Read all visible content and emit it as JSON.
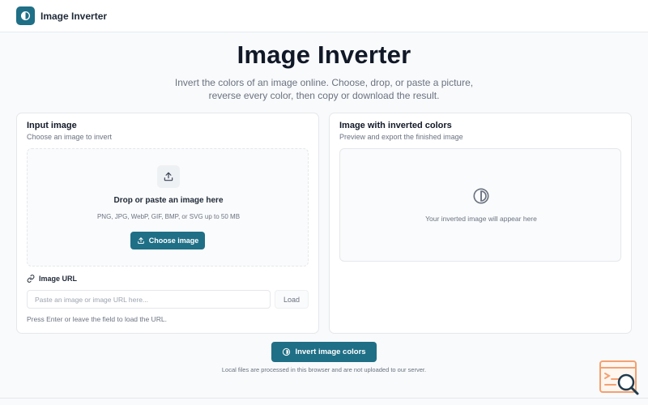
{
  "app": {
    "title": "Image Inverter"
  },
  "hero": {
    "title": "Image Inverter",
    "subtitle": "Invert the colors of an image online. Choose, drop, or paste a picture, reverse every color, then copy or download the result."
  },
  "input_card": {
    "title": "Input image",
    "subtitle": "Choose an image to invert",
    "dropzone": {
      "title": "Drop or paste an image here",
      "formats": "PNG, JPG, WebP, GIF, BMP, or SVG up to 50 MB",
      "button_label": "Choose image"
    },
    "url": {
      "label": "Image URL",
      "placeholder": "Paste an image or image URL here...",
      "value": "",
      "load_label": "Load",
      "hint": "Press Enter or leave the field to load the URL."
    }
  },
  "output_card": {
    "title": "Image with inverted colors",
    "subtitle": "Preview and export the finished image",
    "empty_text": "Your inverted image will appear here"
  },
  "actions": {
    "invert_label": "Invert image colors",
    "footnote": "Local files are processed in this browser and are not uploaded to our server."
  },
  "icons": {
    "logo": "half-circle-icon",
    "upload": "upload-icon",
    "link": "link-icon",
    "preview": "contrast-icon",
    "corner": "search-code-icon"
  },
  "colors": {
    "accent": "#1f6f86",
    "background": "#f8fafb",
    "border": "#e5e7eb",
    "muted_text": "#6b7280",
    "badge_orange": "#f4a172"
  }
}
